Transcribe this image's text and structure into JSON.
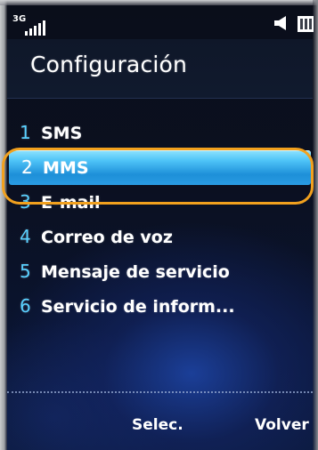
{
  "status_bar": {
    "network": "3G",
    "signal_icon": "signal-strength-icon",
    "speaker_icon": "speaker-icon",
    "battery_icon": "battery-icon"
  },
  "header": {
    "title": "Configuración"
  },
  "menu": {
    "items": [
      {
        "number": "1",
        "label": "SMS",
        "selected": false
      },
      {
        "number": "2",
        "label": "MMS",
        "selected": true
      },
      {
        "number": "3",
        "label": "E-mail",
        "selected": false
      },
      {
        "number": "4",
        "label": "Correo de voz",
        "selected": false
      },
      {
        "number": "5",
        "label": "Mensaje de servicio",
        "selected": false
      },
      {
        "number": "6",
        "label": "Servicio de inform...",
        "selected": false
      }
    ]
  },
  "softkeys": {
    "select_label": "Selec.",
    "back_label": "Volver"
  },
  "colors": {
    "selection_highlight": "#2a9ce3",
    "callout_ring": "#f2a11e",
    "number_accent": "#58d0ff"
  }
}
